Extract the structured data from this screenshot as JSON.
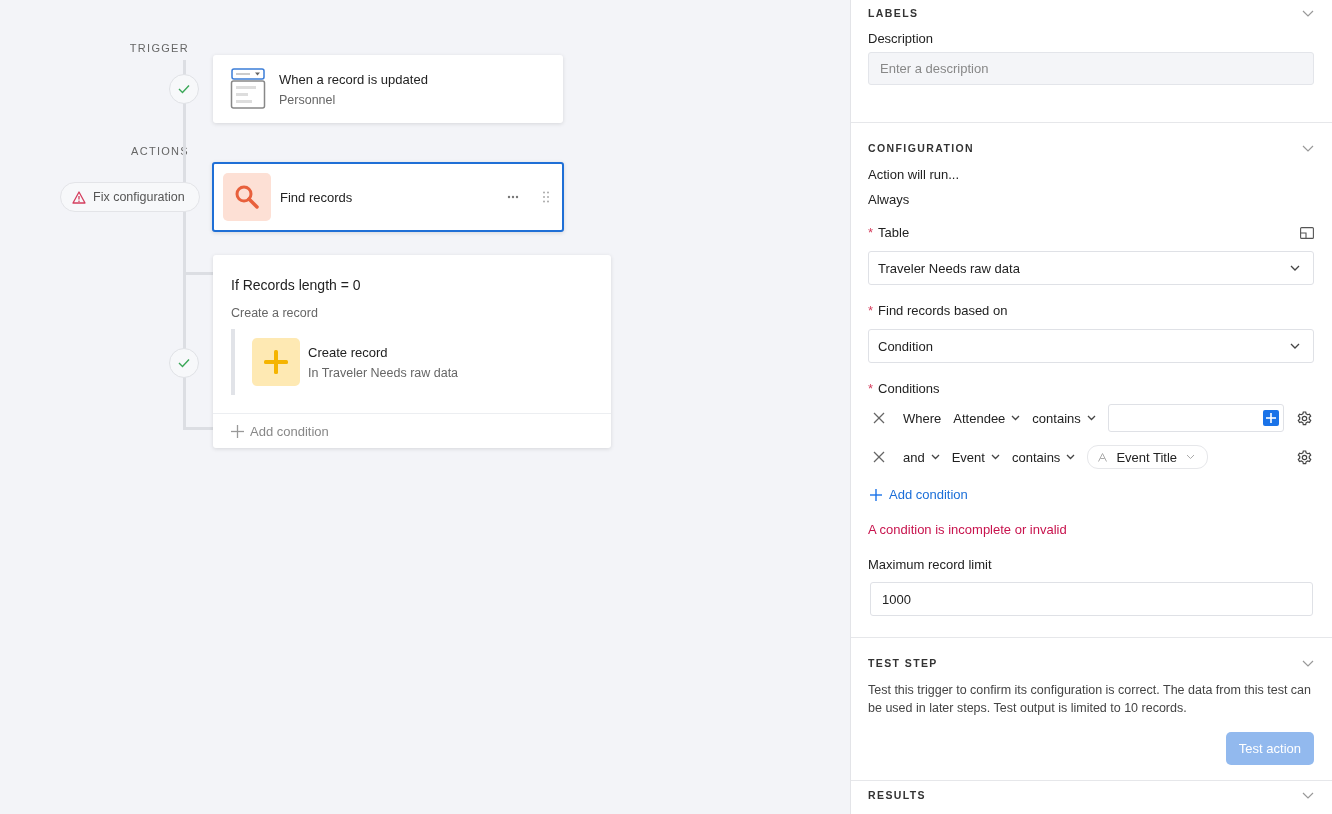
{
  "canvas": {
    "trigger_label": "TRIGGER",
    "trigger": {
      "title": "When a record is updated",
      "subtitle": "Personnel",
      "done": true
    },
    "actions_label": "ACTIONS",
    "actions": [
      {
        "kind": "action",
        "title": "Find records",
        "selected": true,
        "warning": "Fix configuration"
      },
      {
        "kind": "branch",
        "title": "If Records length = 0",
        "subtitle": "Create a record",
        "done": true,
        "step": {
          "title": "Create record",
          "subtitle": "In Traveler Needs raw data"
        },
        "add": "Add condition"
      }
    ]
  },
  "panel": {
    "labels": {
      "title": "LABELS",
      "description_label": "Description",
      "description_placeholder": "Enter a description"
    },
    "configuration": {
      "title": "CONFIGURATION",
      "run_label": "Action will run...",
      "run_value": "Always",
      "table": {
        "marker": "*",
        "label": "Table",
        "value": "Traveler Needs raw data"
      },
      "based_on": {
        "marker": "*",
        "label": "Find records based on",
        "value": "Condition"
      },
      "conditions_marker": "*",
      "conditions_label": "Conditions",
      "conditions": [
        {
          "conjunction": "Where",
          "conjunction_menu": false,
          "field": "Attendee",
          "operator": "contains",
          "kind": "input"
        },
        {
          "conjunction": "and",
          "conjunction_menu": true,
          "field": "Event",
          "operator": "contains",
          "kind": "token",
          "value": "Event Title"
        }
      ],
      "add": "Add condition",
      "error": "A condition is incomplete or invalid",
      "limit_label": "Maximum record limit",
      "limit_value": "1000"
    },
    "test": {
      "title": "TEST STEP",
      "text": "Test this trigger to confirm its configuration is correct. The data from this test can be used in later steps. Test output is limited to 10 records.",
      "button": "Test action",
      "button_disabled": true
    },
    "results": {
      "title": "RESULTS"
    }
  }
}
